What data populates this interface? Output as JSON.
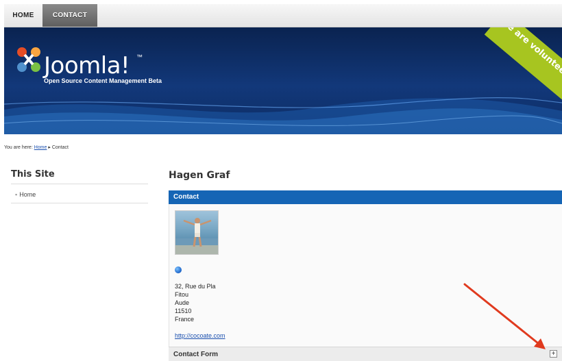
{
  "nav": {
    "items": [
      {
        "label": "HOME"
      },
      {
        "label": "CONTACT",
        "active": true
      }
    ]
  },
  "header": {
    "logo": "Joomla!",
    "logo_tm": "™",
    "tagline": "Open Source Content Management Beta",
    "ribbon": "We are volunteers!"
  },
  "breadcrumb": {
    "prefix": "You are here:",
    "home": "Home",
    "separator": "▸",
    "current": "Contact"
  },
  "sidebar": {
    "title": "This Site",
    "items": [
      {
        "label": "Home"
      }
    ]
  },
  "main": {
    "title": "Hagen Graf",
    "section_label": "Contact",
    "address": [
      "32, Rue du Pla",
      "Fitou",
      "Aude",
      "11510",
      "France"
    ],
    "website": "http://cocoate.com",
    "form_label": "Contact Form",
    "expand_symbol": "+"
  },
  "colors": {
    "header_blue": "#12387a",
    "section_bar": "#1565b5",
    "ribbon_green": "#a7c520",
    "annotation_arrow": "#e03a1e"
  },
  "icons": [
    "joomla-logo-icon",
    "globe-icon",
    "expand-icon",
    "annotation-arrow"
  ]
}
